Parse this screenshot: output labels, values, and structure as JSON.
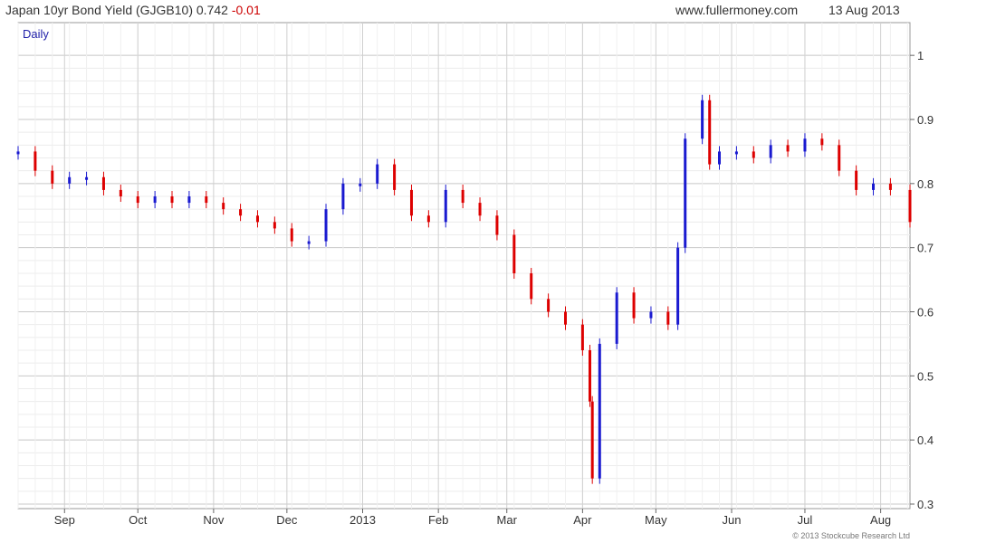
{
  "header": {
    "title": "Japan 10yr Bond Yield (GJGB10) 0.742",
    "change": "-0.01",
    "site": "www.fullermoney.com",
    "date": "13 Aug 2013"
  },
  "period_label": "Daily",
  "copyright": "© 2013 Stockcube Research Ltd",
  "colors": {
    "up": "#1a1ad0",
    "down": "#dd0000",
    "grid": "#d8d8d8",
    "frame": "#999999"
  },
  "chart_data": {
    "type": "line",
    "style": "candlestick-like price series",
    "ylim": [
      0.3,
      1.02
    ],
    "yticks": [
      "0.3",
      "0.4",
      "0.5",
      "0.6",
      "0.7",
      "0.8",
      "0.9",
      "1"
    ],
    "xlim": [
      "2012-08-13",
      "2013-08-13"
    ],
    "xticks": [
      {
        "date": "2012-09-01",
        "label": "Sep"
      },
      {
        "date": "2012-10-01",
        "label": "Oct"
      },
      {
        "date": "2012-11-01",
        "label": "Nov"
      },
      {
        "date": "2012-12-01",
        "label": "Dec"
      },
      {
        "date": "2013-01-01",
        "label": "2013"
      },
      {
        "date": "2013-02-01",
        "label": "Feb"
      },
      {
        "date": "2013-03-01",
        "label": "Mar"
      },
      {
        "date": "2013-04-01",
        "label": "Apr"
      },
      {
        "date": "2013-05-01",
        "label": "May"
      },
      {
        "date": "2013-06-01",
        "label": "Jun"
      },
      {
        "date": "2013-07-01",
        "label": "Jul"
      },
      {
        "date": "2013-08-01",
        "label": "Aug"
      }
    ],
    "grid": true,
    "x": [
      "2012-08-13",
      "2012-08-20",
      "2012-08-27",
      "2012-09-03",
      "2012-09-10",
      "2012-09-17",
      "2012-09-24",
      "2012-10-01",
      "2012-10-08",
      "2012-10-15",
      "2012-10-22",
      "2012-10-29",
      "2012-11-05",
      "2012-11-12",
      "2012-11-19",
      "2012-11-26",
      "2012-12-03",
      "2012-12-10",
      "2012-12-17",
      "2012-12-24",
      "2012-12-31",
      "2013-01-07",
      "2013-01-14",
      "2013-01-21",
      "2013-01-28",
      "2013-02-04",
      "2013-02-11",
      "2013-02-18",
      "2013-02-25",
      "2013-03-04",
      "2013-03-11",
      "2013-03-18",
      "2013-03-25",
      "2013-04-01",
      "2013-04-04",
      "2013-04-05",
      "2013-04-08",
      "2013-04-15",
      "2013-04-22",
      "2013-04-29",
      "2013-05-06",
      "2013-05-10",
      "2013-05-13",
      "2013-05-20",
      "2013-05-23",
      "2013-05-27",
      "2013-06-03",
      "2013-06-10",
      "2013-06-17",
      "2013-06-24",
      "2013-07-01",
      "2013-07-08",
      "2013-07-15",
      "2013-07-22",
      "2013-07-29",
      "2013-08-05",
      "2013-08-13"
    ],
    "y": [
      0.85,
      0.82,
      0.8,
      0.81,
      0.81,
      0.79,
      0.78,
      0.77,
      0.78,
      0.77,
      0.78,
      0.77,
      0.76,
      0.75,
      0.74,
      0.73,
      0.71,
      0.71,
      0.76,
      0.8,
      0.8,
      0.83,
      0.79,
      0.75,
      0.74,
      0.79,
      0.77,
      0.75,
      0.72,
      0.66,
      0.62,
      0.6,
      0.58,
      0.54,
      0.46,
      0.34,
      0.55,
      0.63,
      0.59,
      0.6,
      0.58,
      0.7,
      0.87,
      0.93,
      0.83,
      0.85,
      0.85,
      0.84,
      0.86,
      0.85,
      0.87,
      0.86,
      0.82,
      0.79,
      0.8,
      0.79,
      0.74
    ]
  }
}
